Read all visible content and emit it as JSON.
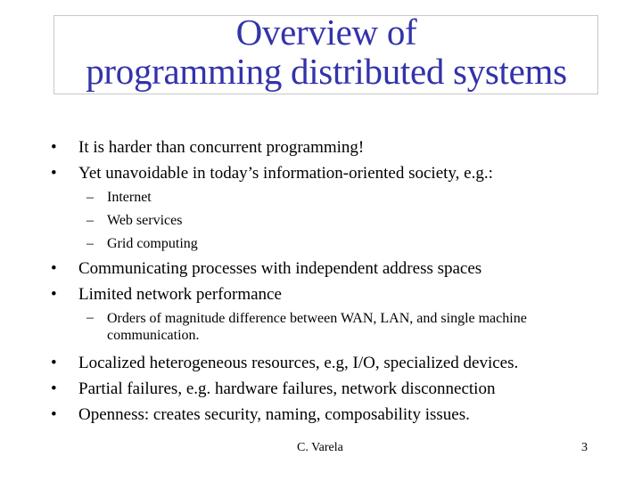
{
  "slide": {
    "title_lines": [
      "Overview of",
      "programming distributed systems"
    ],
    "bullet_glyph": "•",
    "dash_glyph": "–",
    "items": [
      {
        "level": 1,
        "text": "It is harder than concurrent programming!"
      },
      {
        "level": 1,
        "text": "Yet unavoidable in today’s information-oriented society, e.g.:"
      },
      {
        "level": 2,
        "text": "Internet"
      },
      {
        "level": 2,
        "text": "Web services"
      },
      {
        "level": 2,
        "text": "Grid computing"
      },
      {
        "level": 1,
        "text": "Communicating processes with independent address spaces"
      },
      {
        "level": 1,
        "text": "Limited network performance"
      },
      {
        "level": 2,
        "text": "Orders of magnitude difference between WAN, LAN, and single machine communication."
      },
      {
        "level": 1,
        "text": "Localized heterogeneous resources, e.g, I/O, specialized devices."
      },
      {
        "level": 1,
        "text": "Partial failures, e.g. hardware failures, network disconnection"
      },
      {
        "level": 1,
        "text": "Openness:  creates security, naming, composability issues."
      }
    ],
    "footer": {
      "author": "C. Varela",
      "page_number": "3"
    },
    "colors": {
      "title": "#3333aa",
      "text": "#000000",
      "title_border": "#c8c8c8"
    }
  }
}
